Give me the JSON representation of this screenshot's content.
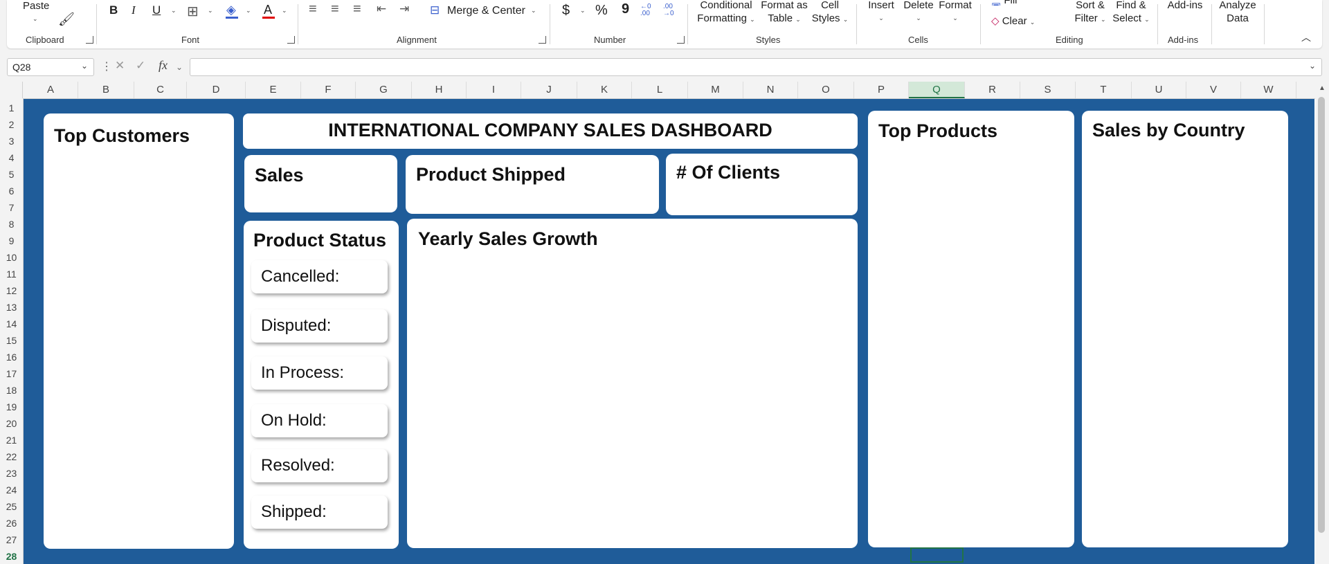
{
  "ribbon": {
    "clipboard": {
      "paste_label": "Paste",
      "group_label": "Clipboard"
    },
    "font": {
      "bold": "B",
      "italic": "I",
      "underline": "U",
      "font_color_letter": "A",
      "group_label": "Font"
    },
    "alignment": {
      "merge_label": "Merge & Center",
      "group_label": "Alignment"
    },
    "number": {
      "currency": "$",
      "percent": "%",
      "comma": "9",
      "increase_decimal": "←0 .00",
      "decrease_decimal": ".00 →0",
      "group_label": "Number"
    },
    "styles": {
      "conditional_1": "Conditional",
      "conditional_2": "Formatting",
      "format_table_1": "Format as",
      "format_table_2": "Table",
      "cell_styles_1": "Cell",
      "cell_styles_2": "Styles",
      "group_label": "Styles"
    },
    "cells": {
      "insert": "Insert",
      "delete": "Delete",
      "format": "Format",
      "group_label": "Cells"
    },
    "editing": {
      "fill": "Fill",
      "clear": "Clear",
      "sort_1": "Sort &",
      "sort_2": "Filter",
      "find_1": "Find &",
      "find_2": "Select",
      "group_label": "Editing"
    },
    "addins": {
      "label": "Add-ins",
      "group_label": "Add-ins"
    },
    "analyze": {
      "label_1": "Analyze",
      "label_2": "Data"
    }
  },
  "formula_bar": {
    "name_box": "Q28",
    "fx": "fx",
    "formula": ""
  },
  "columns": [
    "A",
    "B",
    "C",
    "D",
    "E",
    "F",
    "G",
    "H",
    "I",
    "J",
    "K",
    "L",
    "M",
    "N",
    "O",
    "P",
    "Q",
    "R",
    "S",
    "T",
    "U",
    "V",
    "W"
  ],
  "selected_column": "Q",
  "rows": [
    "1",
    "2",
    "3",
    "4",
    "5",
    "6",
    "7",
    "8",
    "9",
    "10",
    "11",
    "12",
    "13",
    "14",
    "15",
    "16",
    "17",
    "18",
    "19",
    "20",
    "21",
    "22",
    "23",
    "24",
    "25",
    "26",
    "27",
    "28"
  ],
  "selected_row": "28",
  "dashboard": {
    "title": "INTERNATIONAL COMPANY SALES DASHBOARD",
    "top_customers": "Top Customers",
    "sales": "Sales",
    "product_shipped": "Product Shipped",
    "clients": "# Of Clients",
    "product_status": "Product Status",
    "yearly_growth": "Yearly Sales Growth",
    "top_products": "Top Products",
    "sales_by_country": "Sales by Country",
    "statuses": [
      "Cancelled:",
      "Disputed:",
      "In Process:",
      "On Hold:",
      "Resolved:",
      "Shipped:"
    ]
  },
  "colors": {
    "sheet_background": "#1f5c99",
    "accent": "#217346",
    "card": "#ffffff"
  }
}
